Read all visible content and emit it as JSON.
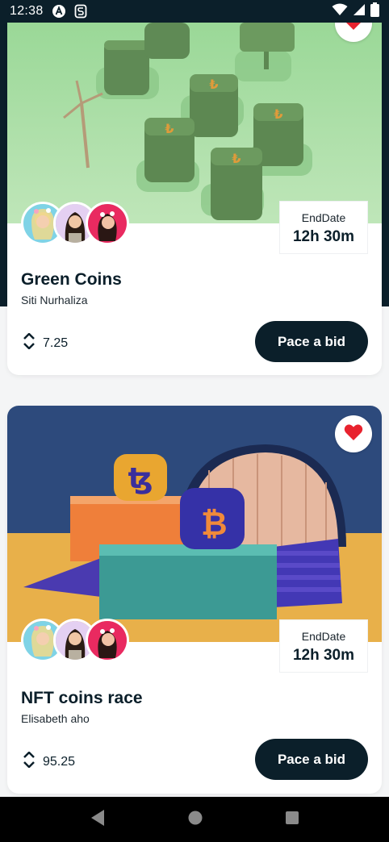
{
  "status_bar": {
    "time": "12:38"
  },
  "cards": [
    {
      "title": "Green Coins",
      "owner": "Siti Nurhaliza",
      "end_label": "EndDate",
      "end_value": "12h 30m",
      "price": "7.25",
      "bid_label": "Pace a bid",
      "favorited": true
    },
    {
      "title": "NFT coins race",
      "owner": "Elisabeth aho",
      "end_label": "EndDate",
      "end_value": "12h 30m",
      "price": "95.25",
      "bid_label": "Pace a bid",
      "favorited": true
    }
  ],
  "colors": {
    "dark": "#0b1f2a",
    "heart": "#e8222e",
    "green_art": "#9fd99a",
    "blue_art": "#2e4a7d"
  },
  "icons": {
    "status_left": [
      "a-app-icon",
      "s-app-icon"
    ],
    "status_right": [
      "wifi-icon",
      "signal-icon",
      "battery-icon"
    ],
    "nav": [
      "back-icon",
      "home-icon",
      "recents-icon"
    ]
  }
}
